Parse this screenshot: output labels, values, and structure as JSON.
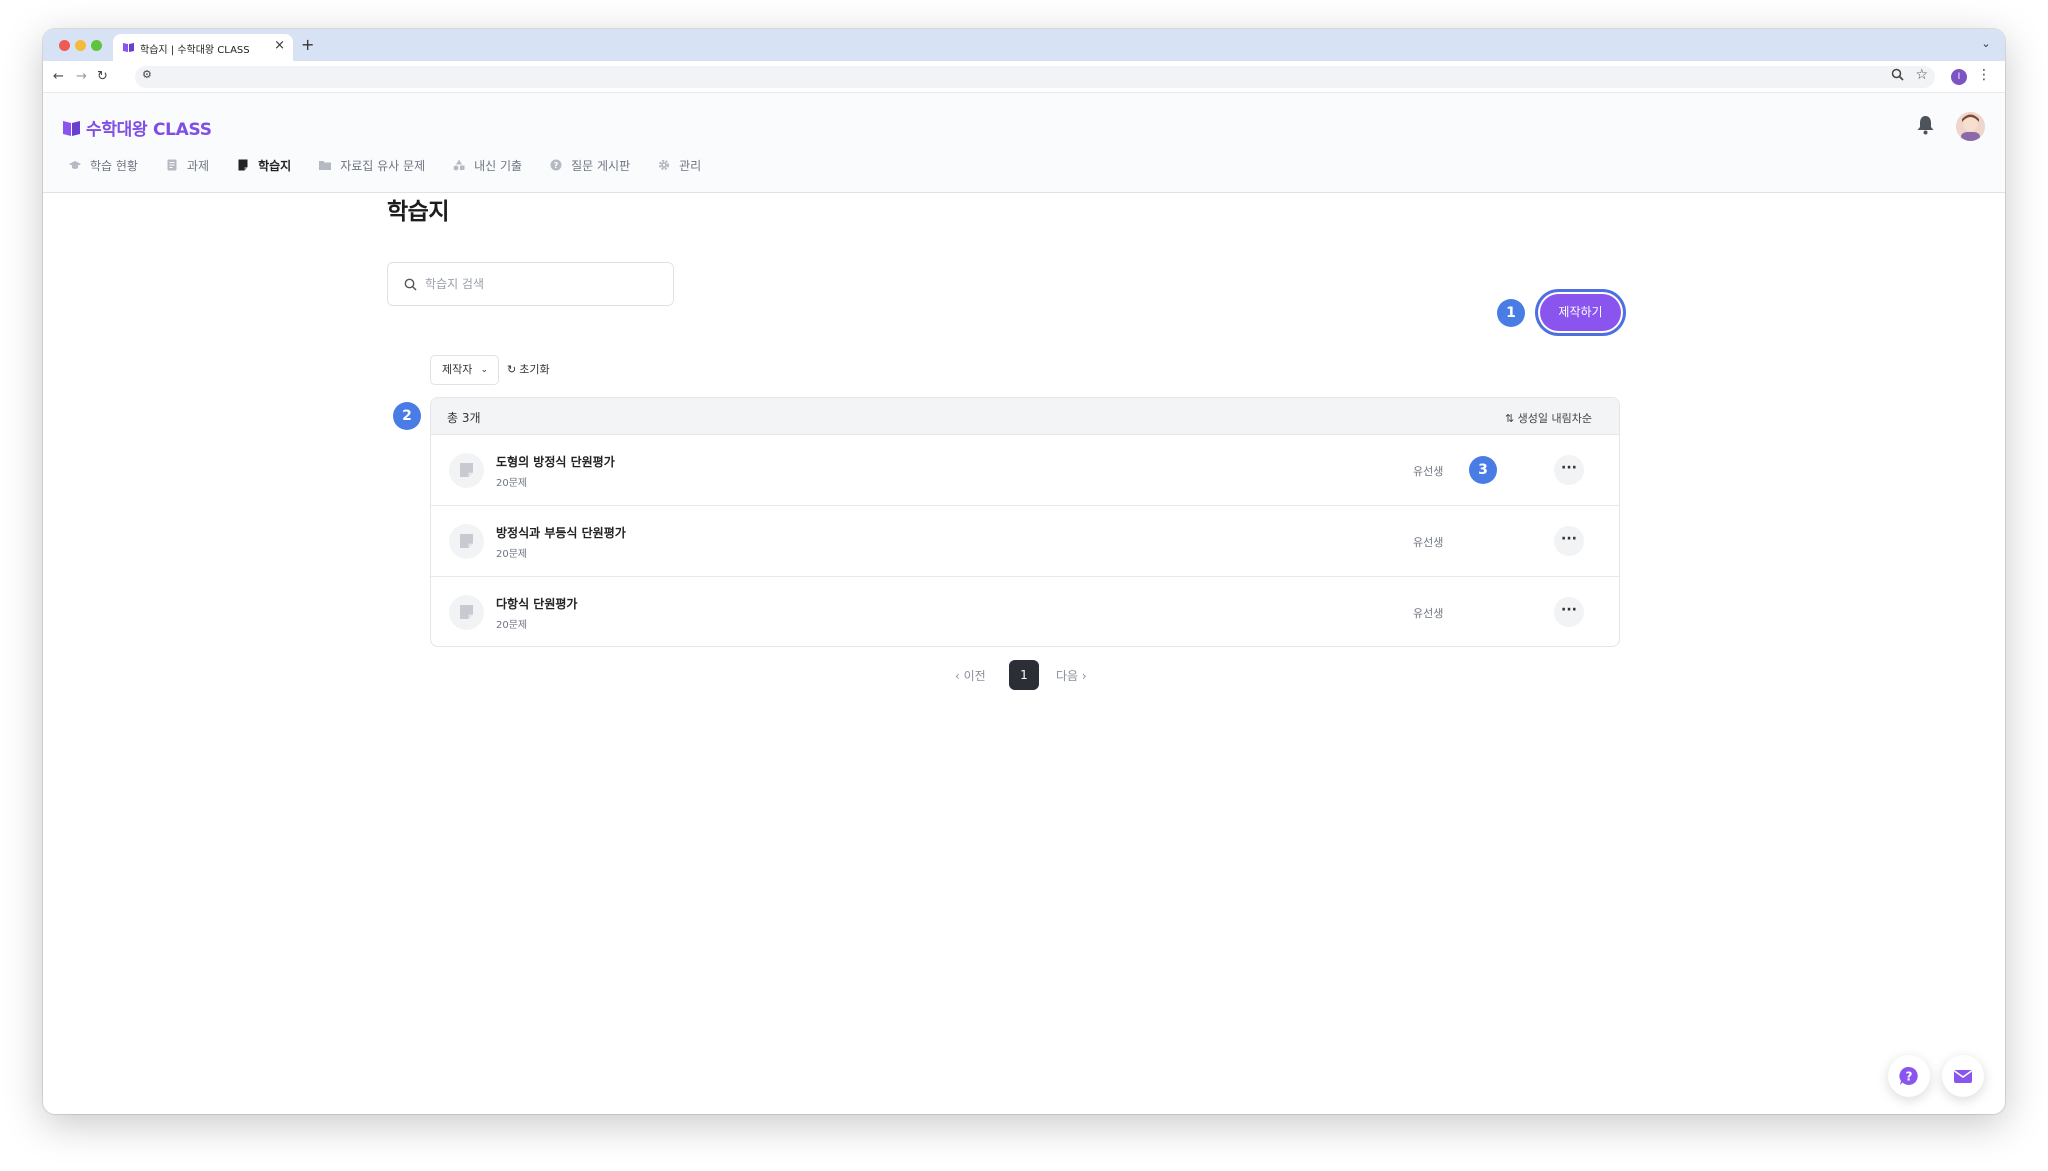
{
  "browser": {
    "tab_title": "학습지 | 수학대왕 CLASS",
    "new_tab": "+",
    "close_tab": "×",
    "profile_initial": "I"
  },
  "app": {
    "logo_text": "수학대왕 CLASS",
    "brand_color": "#7f4ee5"
  },
  "nav": {
    "items": [
      {
        "label": "학습 현황",
        "icon": "graduation-cap-icon"
      },
      {
        "label": "과제",
        "icon": "document-icon"
      },
      {
        "label": "학습지",
        "icon": "note-icon"
      },
      {
        "label": "자료집 유사 문제",
        "icon": "folder-icon"
      },
      {
        "label": "내신 기출",
        "icon": "shapes-icon"
      },
      {
        "label": "질문 게시판",
        "icon": "question-icon"
      },
      {
        "label": "관리",
        "icon": "gear-icon"
      }
    ],
    "active": "학습지"
  },
  "page": {
    "title": "학습지",
    "search_placeholder": "학습지 검색",
    "create_button": "제작하기",
    "filter_label": "제작자",
    "reset_label": "초기화"
  },
  "annotations": [
    "1",
    "2",
    "3"
  ],
  "list": {
    "total_label": "총 3개",
    "sort_label": "생성일 내림차순",
    "rows": [
      {
        "title": "도형의 방정식 단원평가",
        "count": "20문제",
        "author": "유선생"
      },
      {
        "title": "방정식과 부등식 단원평가",
        "count": "20문제",
        "author": "유선생"
      },
      {
        "title": "다항식 단원평가",
        "count": "20문제",
        "author": "유선생"
      }
    ],
    "more_label": "···"
  },
  "pagination": {
    "prev": "이전",
    "current": "1",
    "next": "다음"
  }
}
